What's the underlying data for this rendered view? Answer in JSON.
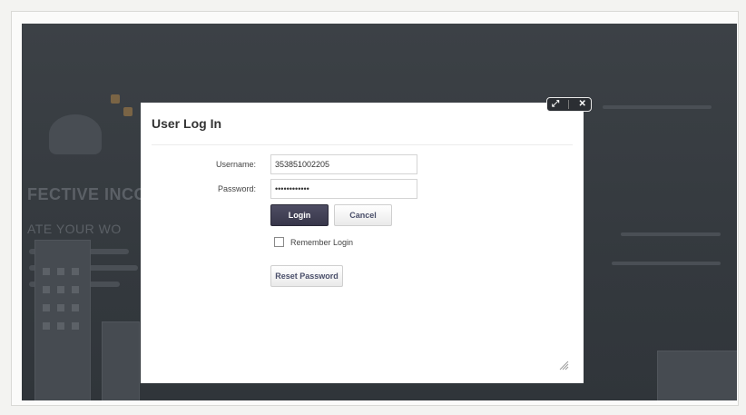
{
  "background_page": {
    "heading_fragment": "FECTIVE INCO",
    "body_fragment": "ATE YOUR WO"
  },
  "modal": {
    "title": "User Log In",
    "username_label": "Username:",
    "username_value": "353851002205",
    "password_label": "Password:",
    "password_value": "••••••••••••",
    "login_label": "Login",
    "cancel_label": "Cancel",
    "remember_label": "Remember Login",
    "remember_checked": false,
    "reset_label": "Reset Password"
  },
  "window_controls": {
    "maximize_icon": "expand-icon",
    "close_icon": "close-icon",
    "maximize_glyph": "⤢",
    "close_glyph": "✕"
  },
  "colors": {
    "backdrop": "#353a3f",
    "primary_button": "#3f3e54",
    "modal_background": "#ffffff"
  }
}
